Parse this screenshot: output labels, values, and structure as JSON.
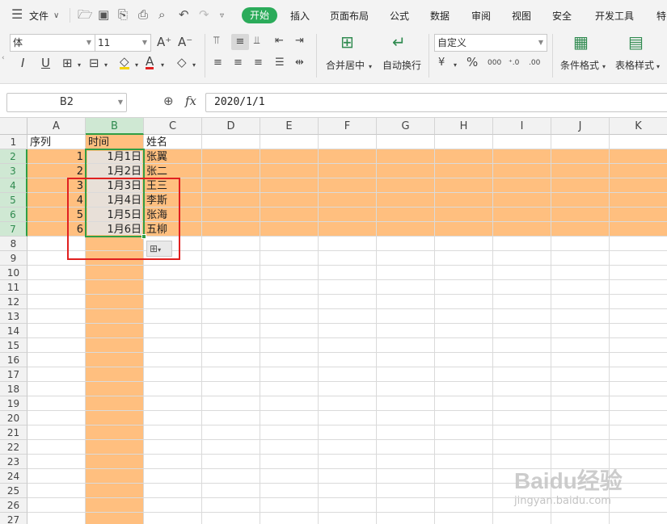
{
  "menu": {
    "hamburger_label": "文件",
    "tabs": [
      "开始",
      "插入",
      "页面布局",
      "公式",
      "数据",
      "审阅",
      "视图",
      "安全",
      "开发工具",
      "特"
    ]
  },
  "ribbon": {
    "font_name": "体",
    "font_size": "11",
    "merge_label": "合并居中",
    "wrap_label": "自动换行",
    "number_format": "自定义",
    "cond_format_label": "条件格式",
    "table_style_label": "表格样式"
  },
  "formula_bar": {
    "name_box": "B2",
    "fx_label": "fx",
    "formula": "2020/1/1"
  },
  "sheet": {
    "columns": [
      "A",
      "B",
      "C",
      "D",
      "E",
      "F",
      "G",
      "H",
      "I",
      "J",
      "K"
    ],
    "rows": [
      "1",
      "2",
      "3",
      "4",
      "5",
      "6",
      "7",
      "8",
      "9",
      "10",
      "11",
      "12",
      "13",
      "14",
      "15",
      "16",
      "17",
      "18",
      "19",
      "20",
      "21",
      "22",
      "23",
      "24",
      "25",
      "26",
      "27"
    ],
    "header": {
      "a": "序列",
      "b": "时间",
      "c": "姓名"
    },
    "data": [
      {
        "seq": "1",
        "date": "1月1日",
        "name": "张翼"
      },
      {
        "seq": "2",
        "date": "1月2日",
        "name": "张二"
      },
      {
        "seq": "3",
        "date": "1月3日",
        "name": "王三"
      },
      {
        "seq": "4",
        "date": "1月4日",
        "name": "李斯"
      },
      {
        "seq": "5",
        "date": "1月5日",
        "name": "张海"
      },
      {
        "seq": "6",
        "date": "1月6日",
        "name": "五柳"
      }
    ],
    "highlight_color": "#ffbf7f",
    "selection_color": "#2f9e44",
    "annotation_color": "#e02020"
  },
  "watermark": {
    "brand": "Baidu经验",
    "url": "jingyan.baidu.com"
  }
}
